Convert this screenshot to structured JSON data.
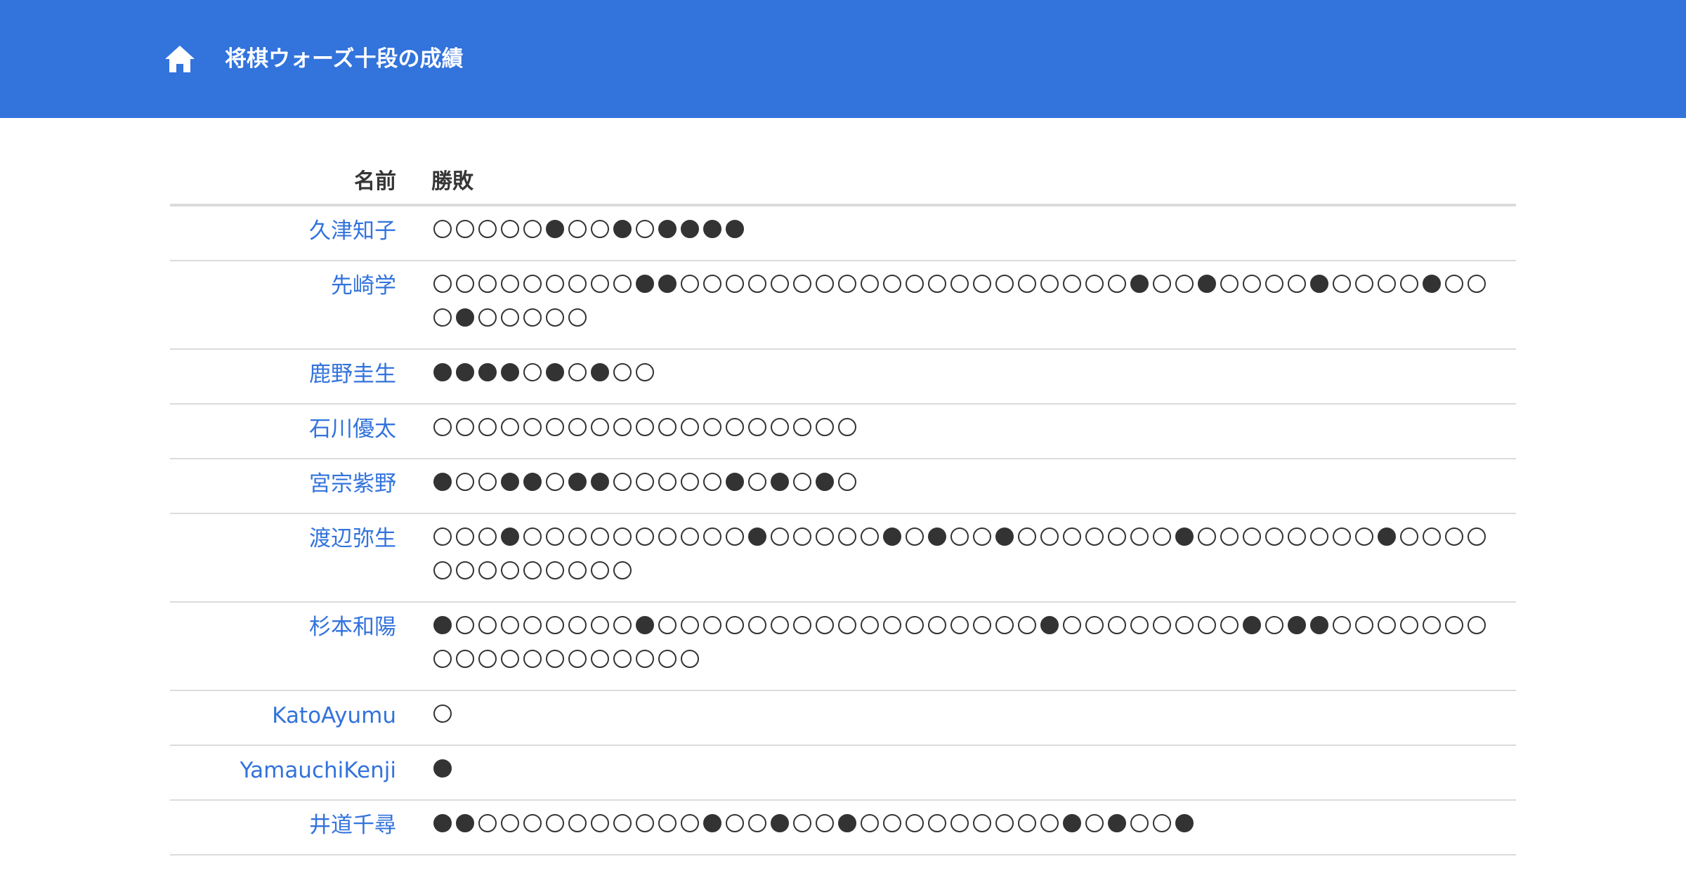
{
  "header": {
    "home_icon": "home-icon",
    "title": "将棋ウォーズ十段の成績",
    "bg_color": "#3273dc"
  },
  "table": {
    "headers": {
      "name": "名前",
      "result": "勝敗"
    },
    "rows": [
      {
        "name": "久津知子",
        "results": "○○○○○●○○●○●●●●"
      },
      {
        "name": "先崎学",
        "results": "○○○○○○○○○●●○○○○○○○○○○○○○○○○○○○○●○○●○○○○●○○○○●○○○●○○○○○"
      },
      {
        "name": "鹿野圭生",
        "results": "●●●●○●○●○○"
      },
      {
        "name": "石川優太",
        "results": "○○○○○○○○○○○○○○○○○○○"
      },
      {
        "name": "宮宗紫野",
        "results": "●○○●●○●●○○○○○●○●○●○"
      },
      {
        "name": "渡辺弥生",
        "results": "○○○●○○○○○○○○○○●○○○○○●○●○○●○○○○○○○●○○○○○○○○●○○○○○○○○○○○○○"
      },
      {
        "name": "杉本和陽",
        "results": "●○○○○○○○○●○○○○○○○○○○○○○○○○○●○○○○○○○○●○●●○○○○○○○○○○○○○○○○○○○"
      },
      {
        "name": "KatoAyumu",
        "results": "○"
      },
      {
        "name": "YamauchiKenji",
        "results": "●"
      },
      {
        "name": "井道千尋",
        "results": "●●○○○○○○○○○○●○○●○○●○○○○○○○○○●○●○○●"
      }
    ]
  },
  "legend": {
    "win": "○",
    "loss": "●"
  },
  "colors": {
    "link": "#3273dc",
    "mark": "#333333"
  }
}
